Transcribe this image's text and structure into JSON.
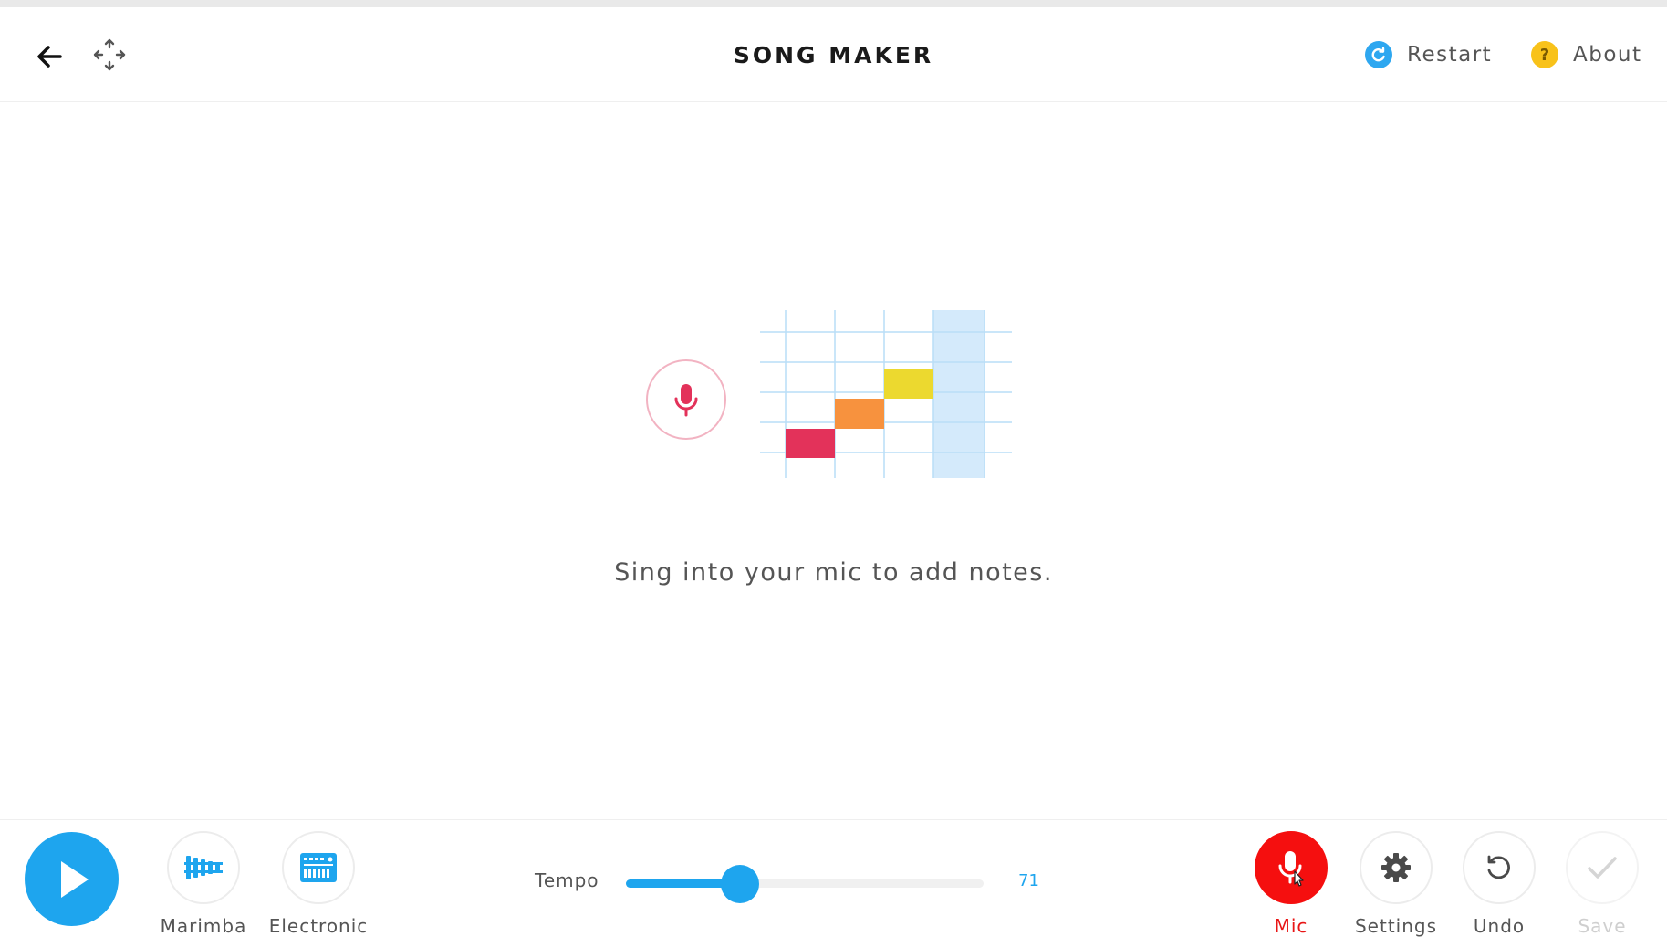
{
  "header": {
    "title": "SONG MAKER",
    "restart_label": "Restart",
    "about_label": "About",
    "about_glyph": "?"
  },
  "main": {
    "message": "Sing into your mic to add notes."
  },
  "bottom": {
    "instruments": [
      {
        "label": "Marimba",
        "icon": "marimba-icon"
      },
      {
        "label": "Electronic",
        "icon": "electronic-icon"
      }
    ],
    "tempo": {
      "label": "Tempo",
      "value": "71",
      "fill_fraction": 0.32
    },
    "actions": {
      "mic_label": "Mic",
      "settings_label": "Settings",
      "undo_label": "Undo",
      "save_label": "Save"
    }
  },
  "colors": {
    "accent": "#1ea5ee",
    "mic_active": "#f50f0f",
    "note_red": "#e3325a",
    "note_orange": "#f7923e",
    "note_yellow": "#ecd92f",
    "restart_dot": "#2ea7f0",
    "about_dot": "#f8c21a"
  }
}
